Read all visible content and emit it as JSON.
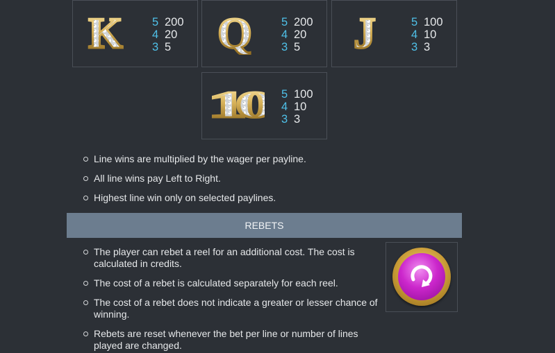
{
  "paytable": [
    {
      "symbol": "K",
      "icon": "diamond-letter-k-icon",
      "payouts": [
        {
          "count": "5",
          "value": "200"
        },
        {
          "count": "4",
          "value": "20"
        },
        {
          "count": "3",
          "value": "5"
        }
      ]
    },
    {
      "symbol": "Q",
      "icon": "diamond-letter-q-icon",
      "payouts": [
        {
          "count": "5",
          "value": "200"
        },
        {
          "count": "4",
          "value": "20"
        },
        {
          "count": "3",
          "value": "5"
        }
      ]
    },
    {
      "symbol": "J",
      "icon": "diamond-letter-j-icon",
      "payouts": [
        {
          "count": "5",
          "value": "100"
        },
        {
          "count": "4",
          "value": "10"
        },
        {
          "count": "3",
          "value": "3"
        }
      ]
    },
    {
      "symbol": "10",
      "icon": "diamond-number-10-icon",
      "payouts": [
        {
          "count": "5",
          "value": "100"
        },
        {
          "count": "4",
          "value": "10"
        },
        {
          "count": "3",
          "value": "3"
        }
      ]
    }
  ],
  "line_rules": [
    "Line wins are multiplied by the wager per payline.",
    "All line wins pay Left to Right.",
    "Highest line win only on selected paylines."
  ],
  "rebets": {
    "title": "REBETS",
    "button_icon": "rebet-circular-arrow-icon",
    "rules": [
      "The player can rebet a reel for an additional cost. The cost is calculated in credits.",
      "The cost of a rebet is calculated separately for each reel.",
      "The cost of a rebet does not indicate a greater or lesser chance of winning.",
      "Rebets are reset whenever the bet per line or number of lines played are changed."
    ]
  },
  "colors": {
    "background": "#2c3036",
    "accent_numbers": "#4fc1e9",
    "section_header": "#6c7d8f",
    "gold": "#d7b25a",
    "magenta": "#cc27cc"
  }
}
